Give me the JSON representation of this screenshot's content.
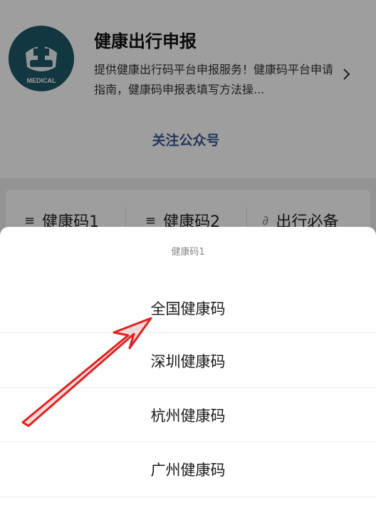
{
  "profile": {
    "name": "健康出行申报",
    "description": "提供健康出行码平台申报服务！健康码平台申请指南，健康码申报表填写方法操...",
    "avatar_text": "MEDICAL",
    "follow_label": "关注公众号"
  },
  "menu": {
    "items": [
      {
        "label": "健康码1",
        "icon": "list-icon"
      },
      {
        "label": "健康码2",
        "icon": "list-icon"
      },
      {
        "label": "出行必备",
        "icon": "mini-program-icon"
      }
    ]
  },
  "sheet": {
    "title": "健康码1",
    "options": [
      {
        "label": "全国健康码"
      },
      {
        "label": "深圳健康码"
      },
      {
        "label": "杭州健康码"
      },
      {
        "label": "广州健康码"
      }
    ]
  },
  "colors": {
    "accent_link": "#3e5a94",
    "annotation_arrow": "#e02020",
    "avatar_bg": "#1d5a68"
  }
}
